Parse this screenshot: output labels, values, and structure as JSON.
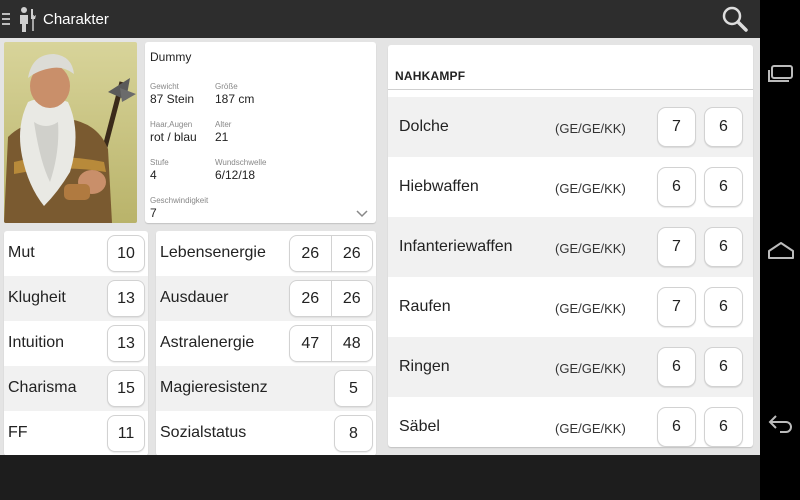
{
  "app": {
    "title": "Charakter"
  },
  "character": {
    "name": "Dummy",
    "gewicht_label": "Gewicht",
    "gewicht": "87 Stein",
    "groesse_label": "Größe",
    "groesse": "187 cm",
    "haar_label": "Haar,Augen",
    "haar": "rot / blau",
    "alter_label": "Alter",
    "alter": "21",
    "stufe_label": "Stufe",
    "stufe": "4",
    "wund_label": "Wundschwelle",
    "wund": "6/12/18",
    "gesch_label": "Geschwindigkeit",
    "gesch": "7"
  },
  "attributes": [
    {
      "label": "Mut",
      "value": "10"
    },
    {
      "label": "Klugheit",
      "value": "13"
    },
    {
      "label": "Intuition",
      "value": "13"
    },
    {
      "label": "Charisma",
      "value": "15"
    },
    {
      "label": "FF",
      "value": "11"
    }
  ],
  "energies": [
    {
      "label": "Lebensenergie",
      "v1": "26",
      "v2": "26"
    },
    {
      "label": "Ausdauer",
      "v1": "26",
      "v2": "26"
    },
    {
      "label": "Astralenergie",
      "v1": "47",
      "v2": "48"
    },
    {
      "label": "Magieresistenz",
      "v1": "5"
    },
    {
      "label": "Sozialstatus",
      "v1": "8"
    }
  ],
  "nahkampf": {
    "title": "NAHKAMPF",
    "rows": [
      {
        "name": "Dolche",
        "attr": "(GE/GE/KK)",
        "at": "7",
        "pa": "6"
      },
      {
        "name": "Hiebwaffen",
        "attr": "(GE/GE/KK)",
        "at": "6",
        "pa": "6"
      },
      {
        "name": "Infanteriewaffen",
        "attr": "(GE/GE/KK)",
        "at": "7",
        "pa": "6"
      },
      {
        "name": "Raufen",
        "attr": "(GE/GE/KK)",
        "at": "7",
        "pa": "6"
      },
      {
        "name": "Ringen",
        "attr": "(GE/GE/KK)",
        "at": "6",
        "pa": "6"
      },
      {
        "name": "Säbel",
        "attr": "(GE/GE/KK)",
        "at": "6",
        "pa": "6"
      }
    ]
  },
  "icons": {
    "menu": "menu-icon",
    "app": "character-icon",
    "search": "search-icon",
    "recent": "recent-apps-icon",
    "home": "home-icon",
    "back": "back-icon",
    "dropdown": "chevron-down-icon"
  },
  "colors": {
    "actionbar": "#2d2d2d",
    "background": "#e4e4e4",
    "card": "#ffffff"
  }
}
